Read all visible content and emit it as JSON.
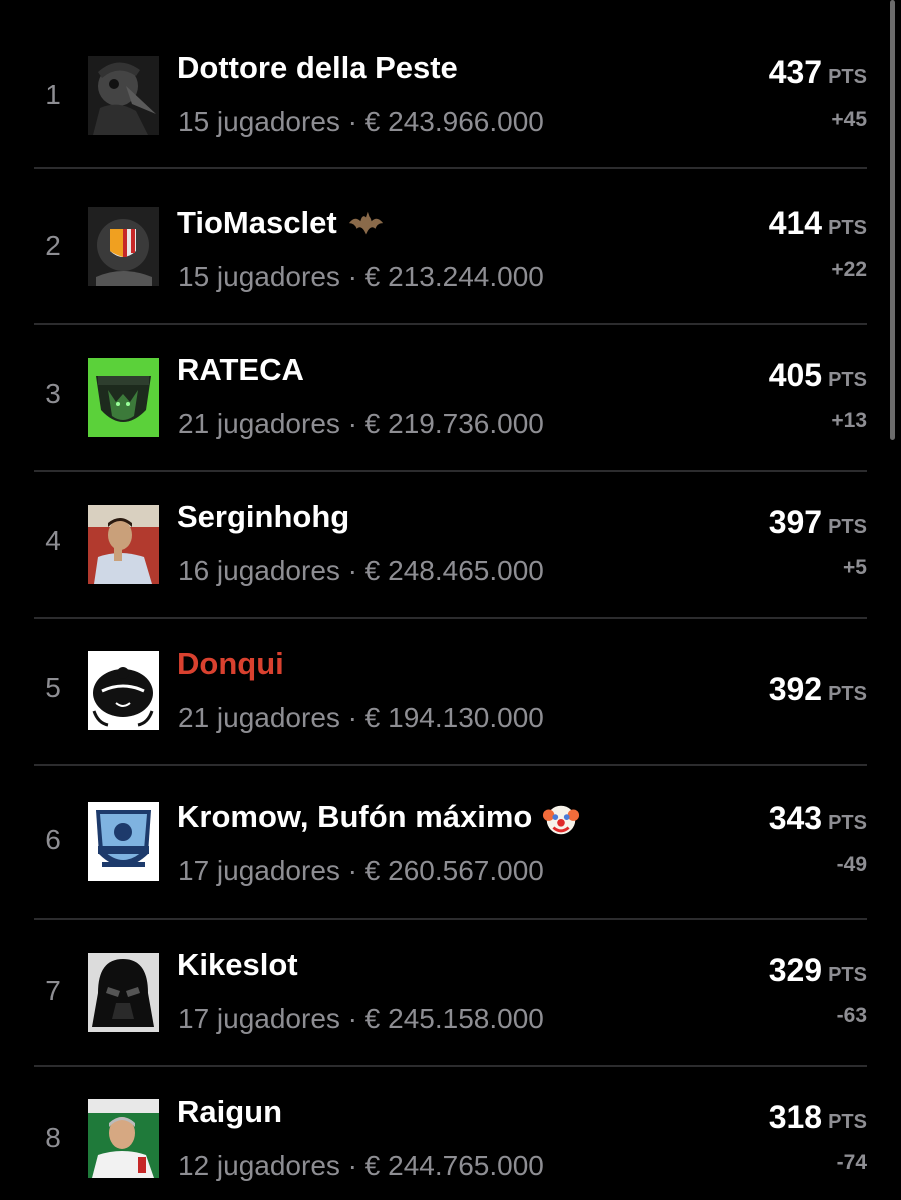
{
  "standings": [
    {
      "rank": "1",
      "name": "Dottore della Peste",
      "meta": "15 jugadores · € 243.966.000",
      "points": "437",
      "points_unit": "PTS",
      "delta": "+45",
      "avatar": "plague-doctor-avatar",
      "name_color": "#ffffff"
    },
    {
      "rank": "2",
      "name": "TioMasclet",
      "name_emoji": "bat-icon",
      "meta": "15 jugadores · € 213.244.000",
      "points": "414",
      "points_unit": "PTS",
      "delta": "+22",
      "avatar": "valencia-crest-avatar",
      "name_color": "#ffffff"
    },
    {
      "rank": "3",
      "name": "RATECA",
      "meta": "21 jugadores · € 219.736.000",
      "points": "405",
      "points_unit": "PTS",
      "delta": "+13",
      "avatar": "rateca-shield-avatar",
      "name_color": "#ffffff"
    },
    {
      "rank": "4",
      "name": "Serginhohg",
      "meta": "16 jugadores · € 248.465.000",
      "points": "397",
      "points_unit": "PTS",
      "delta": "+5",
      "avatar": "footballer-photo-avatar",
      "name_color": "#ffffff"
    },
    {
      "rank": "5",
      "name": "Donqui",
      "meta": "21 jugadores · € 194.130.000",
      "points": "392",
      "points_unit": "PTS",
      "delta": "",
      "avatar": "dq-laurel-avatar",
      "name_color": "#d9412f"
    },
    {
      "rank": "6",
      "name": "Kromow, Bufón máximo",
      "name_emoji": "clown-face-icon",
      "meta": "17 jugadores · € 260.567.000",
      "points": "343",
      "points_unit": "PTS",
      "delta": "-49",
      "avatar": "kromow-badge-avatar",
      "name_color": "#ffffff"
    },
    {
      "rank": "7",
      "name": "Kikeslot",
      "meta": "17 jugadores · € 245.158.000",
      "points": "329",
      "points_unit": "PTS",
      "delta": "-63",
      "avatar": "darth-vader-avatar",
      "name_color": "#ffffff"
    },
    {
      "rank": "8",
      "name": "Raigun",
      "meta": "12 jugadores · € 244.765.000",
      "points": "318",
      "points_unit": "PTS",
      "delta": "-74",
      "avatar": "man-photo-avatar",
      "name_color": "#ffffff"
    }
  ],
  "colors": {
    "background": "#000000",
    "muted_text": "#8e8e93",
    "highlight_name": "#d9412f",
    "divider": "#2c2c2e"
  }
}
